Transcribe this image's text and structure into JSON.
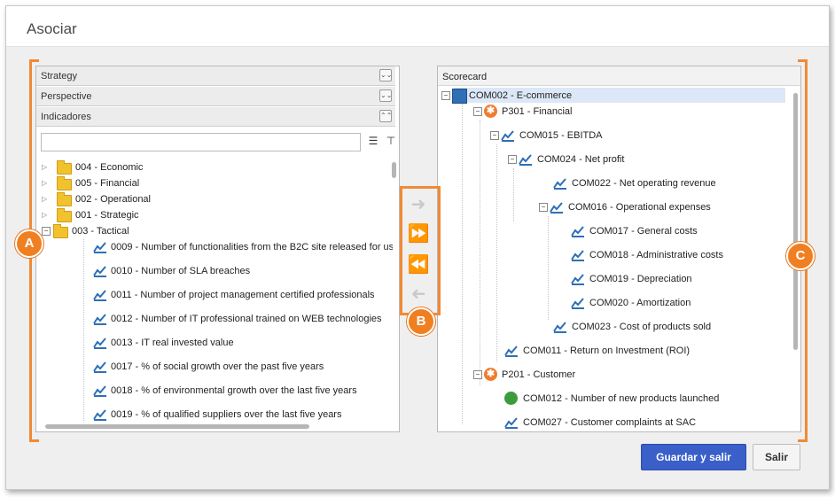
{
  "window": {
    "title": "Asociar"
  },
  "left": {
    "sections": [
      "Strategy",
      "Perspective",
      "Indicadores"
    ],
    "search_placeholder": "",
    "folders": [
      "004 - Economic",
      "005 - Financial",
      "002 - Operational",
      "001 - Strategic",
      "003 - Tactical"
    ],
    "indicators": [
      "0009 - Number of functionalities from the B2C site released for us",
      "0010 - Number of SLA breaches",
      "0011 - Number of project management certified professionals",
      "0012 - Number of IT professional trained on WEB technologies",
      "0013 - IT real invested value",
      "0017 - % of social growth over the past five years",
      "0018 - % of environmental growth over the last five years",
      "0019 - % of qualified suppliers over the last five years"
    ]
  },
  "right": {
    "header": "Scorecard",
    "tree": [
      "COM002 - E-commerce",
      "P301 - Financial",
      "COM015 - EBITDA",
      "COM024 - Net profit",
      "COM022 - Net operating revenue",
      "COM016 - Operational expenses",
      "COM017 - General costs",
      "COM018 - Administrative costs",
      "COM019 - Depreciation",
      "COM020 - Amortization",
      "COM023 - Cost of products sold",
      "COM011 - Return on Investment (ROI)",
      "P201 - Customer",
      "COM012 - Number of new products launched",
      "COM027 - Customer complaints at SAC"
    ]
  },
  "buttons": {
    "save": "Guardar y salir",
    "exit": "Salir"
  },
  "callouts": {
    "a": "A",
    "b": "B",
    "c": "C"
  },
  "colors": {
    "accent": "#f08a35",
    "primary": "#3a5fc9"
  }
}
